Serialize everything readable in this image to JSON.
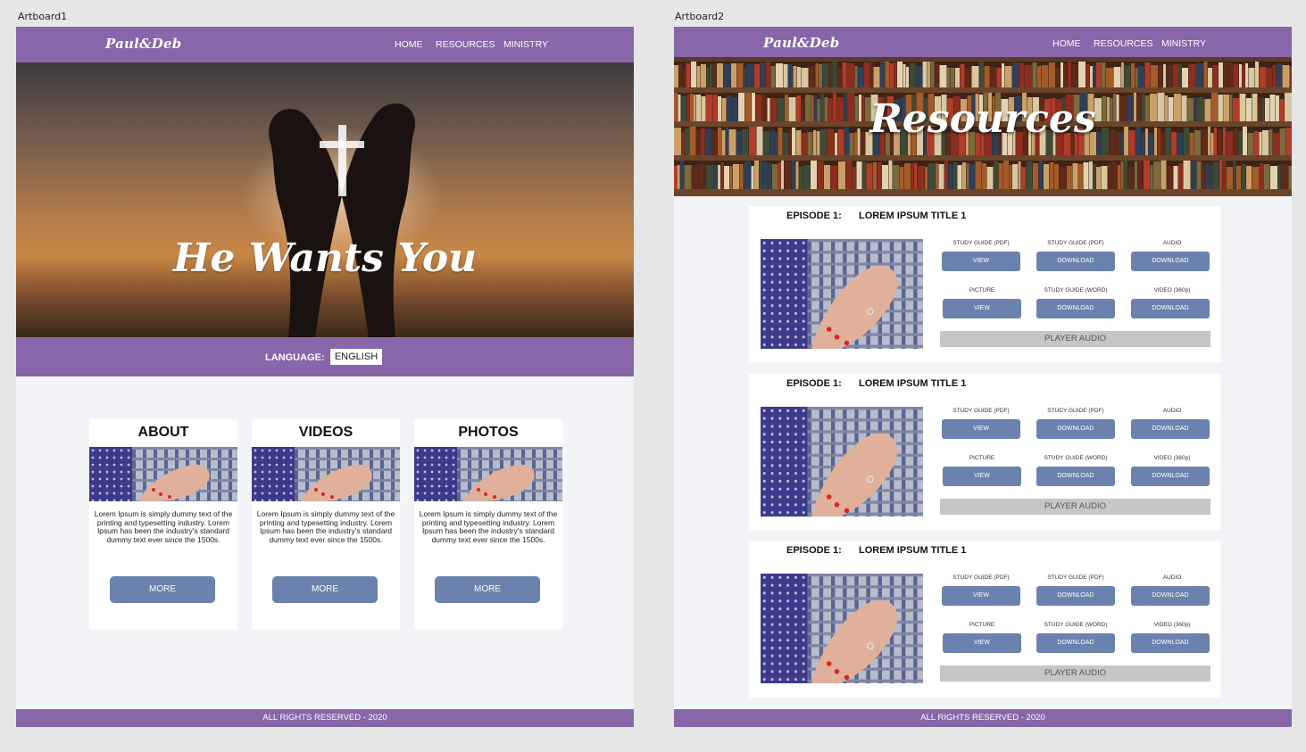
{
  "artboards": {
    "left_label": "Artboard1",
    "right_label": "Artboard2"
  },
  "header": {
    "logo": "Paul&Deb",
    "nav": [
      "HOME",
      "RESOURCES",
      "MINISTRY"
    ]
  },
  "home": {
    "hero_title": "He Wants You",
    "language_label": "LANGUAGE:",
    "language_value": "ENGLISH",
    "cards": [
      {
        "title": "ABOUT",
        "text": "Lorem Ipsum is simply dummy text of the printing and typesetting industry. Lorem Ipsum has been the industry's standard dummy text ever since the 1500s.",
        "button": "MORE"
      },
      {
        "title": "VIDEOS",
        "text": "Lorem Ipsum is simply dummy text of the printing and typesetting industry. Lorem Ipsum has been the industry's standard dummy text ever since the 1500s.",
        "button": "MORE"
      },
      {
        "title": "PHOTOS",
        "text": "Lorem Ipsum is simply dummy text of the printing and typesetting industry. Lorem Ipsum has been the industry's standard dummy text ever since the 1500s.",
        "button": "MORE"
      }
    ]
  },
  "resources": {
    "hero_title": "Resources",
    "episodes": [
      {
        "number": "EPISODE 1:",
        "title": "LOREM IPSUM TITLE 1",
        "items": [
          {
            "label": "STUDY GUIDE (PDF)",
            "button": "VIEW"
          },
          {
            "label": "STUDY GUIDE (PDF)",
            "button": "DOWNLOAD"
          },
          {
            "label": "AUDIO",
            "button": "DOWNLOAD"
          },
          {
            "label": "PICTURE",
            "button": "VIEW"
          },
          {
            "label": "STUDY GUIDE (WORD)",
            "button": "DOWNLOAD"
          },
          {
            "label": "VIDEO (360p)",
            "button": "DOWNLOAD"
          }
        ],
        "player": "PLAYER AUDIO"
      },
      {
        "number": "EPISODE 1:",
        "title": "LOREM IPSUM TITLE 1",
        "items": [
          {
            "label": "STUDY GUIDE (PDF)",
            "button": "VIEW"
          },
          {
            "label": "STUDY GUIDE (PDF)",
            "button": "DOWNLOAD"
          },
          {
            "label": "AUDIO",
            "button": "DOWNLOAD"
          },
          {
            "label": "PICTURE",
            "button": "VIEW"
          },
          {
            "label": "STUDY GUIDE (WORD)",
            "button": "DOWNLOAD"
          },
          {
            "label": "VIDEO (360p)",
            "button": "DOWNLOAD"
          }
        ],
        "player": "PLAYER AUDIO"
      },
      {
        "number": "EPISODE 1:",
        "title": "LOREM IPSUM TITLE 1",
        "items": [
          {
            "label": "STUDY GUIDE (PDF)",
            "button": "VIEW"
          },
          {
            "label": "STUDY GUIDE (PDF)",
            "button": "DOWNLOAD"
          },
          {
            "label": "AUDIO",
            "button": "DOWNLOAD"
          },
          {
            "label": "PICTURE",
            "button": "VIEW"
          },
          {
            "label": "STUDY GUIDE (WORD)",
            "button": "DOWNLOAD"
          },
          {
            "label": "VIDEO (360p)",
            "button": "DOWNLOAD"
          }
        ],
        "player": "PLAYER AUDIO"
      }
    ]
  },
  "footer": {
    "text": "ALL RIGHTS RESERVED - 2020"
  },
  "colors": {
    "brand_purple": "#8766aa",
    "button_blue": "#6a82ad",
    "player_gray": "#c6c6c6",
    "page_bg": "#f2f4f8"
  }
}
